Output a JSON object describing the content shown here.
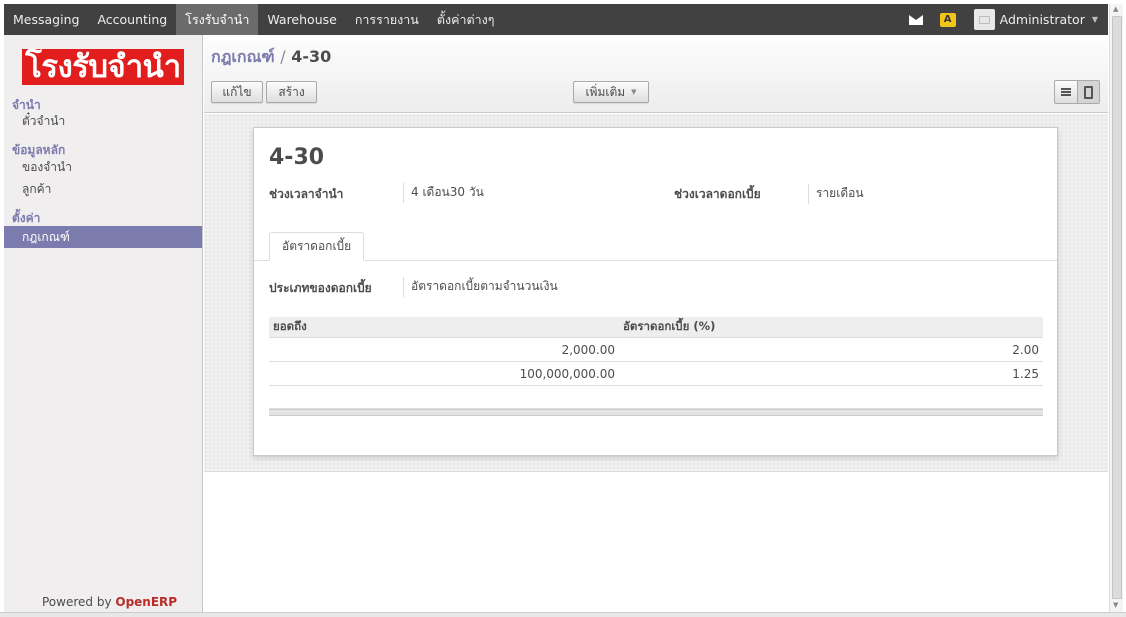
{
  "topbar": {
    "menu": [
      "Messaging",
      "Accounting",
      "โรงรับจำนำ",
      "Warehouse",
      "การรายงาน",
      "ตั้งค่าต่างๆ"
    ],
    "user_name": "Administrator"
  },
  "sidebar": {
    "logo_text": "โรงรับจำนำ",
    "sections": [
      {
        "title": "จำนำ",
        "items": [
          "ตั๋วจำนำ"
        ]
      },
      {
        "title": "ข้อมูลหลัก",
        "items": [
          "ของจำนำ",
          "ลูกค้า"
        ]
      },
      {
        "title": "ตั้งค่า",
        "items": [
          "กฎเกณฑ์"
        ]
      }
    ],
    "powered_prefix": "Powered by ",
    "powered_brand": "OpenERP"
  },
  "header": {
    "breadcrumb_parent": "กฎเกณฑ์",
    "breadcrumb_sep": "/",
    "breadcrumb_current": "4-30",
    "edit_label": "แก้ไข",
    "create_label": "สร้าง",
    "more_label": "เพิ่มเติม"
  },
  "form": {
    "title": "4-30",
    "period_label": "ช่วงเวลาจำนำ",
    "period_value": "4 เดือน30 วัน",
    "interest_period_label": "ช่วงเวลาดอกเบี้ย",
    "interest_period_value": "รายเดือน",
    "tab_label": "อัตราดอกเบี้ย",
    "interest_type_label": "ประเภทของดอกเบี้ย",
    "interest_type_value": "อัตราดอกเบี้ยตามจำนวนเงิน",
    "table": {
      "headers": [
        "ยอดถึง",
        "อัตราดอกเบี้ย (%)"
      ],
      "rows": [
        [
          "2,000.00",
          "2.00"
        ],
        [
          "100,000,000.00",
          "1.25"
        ]
      ]
    }
  }
}
